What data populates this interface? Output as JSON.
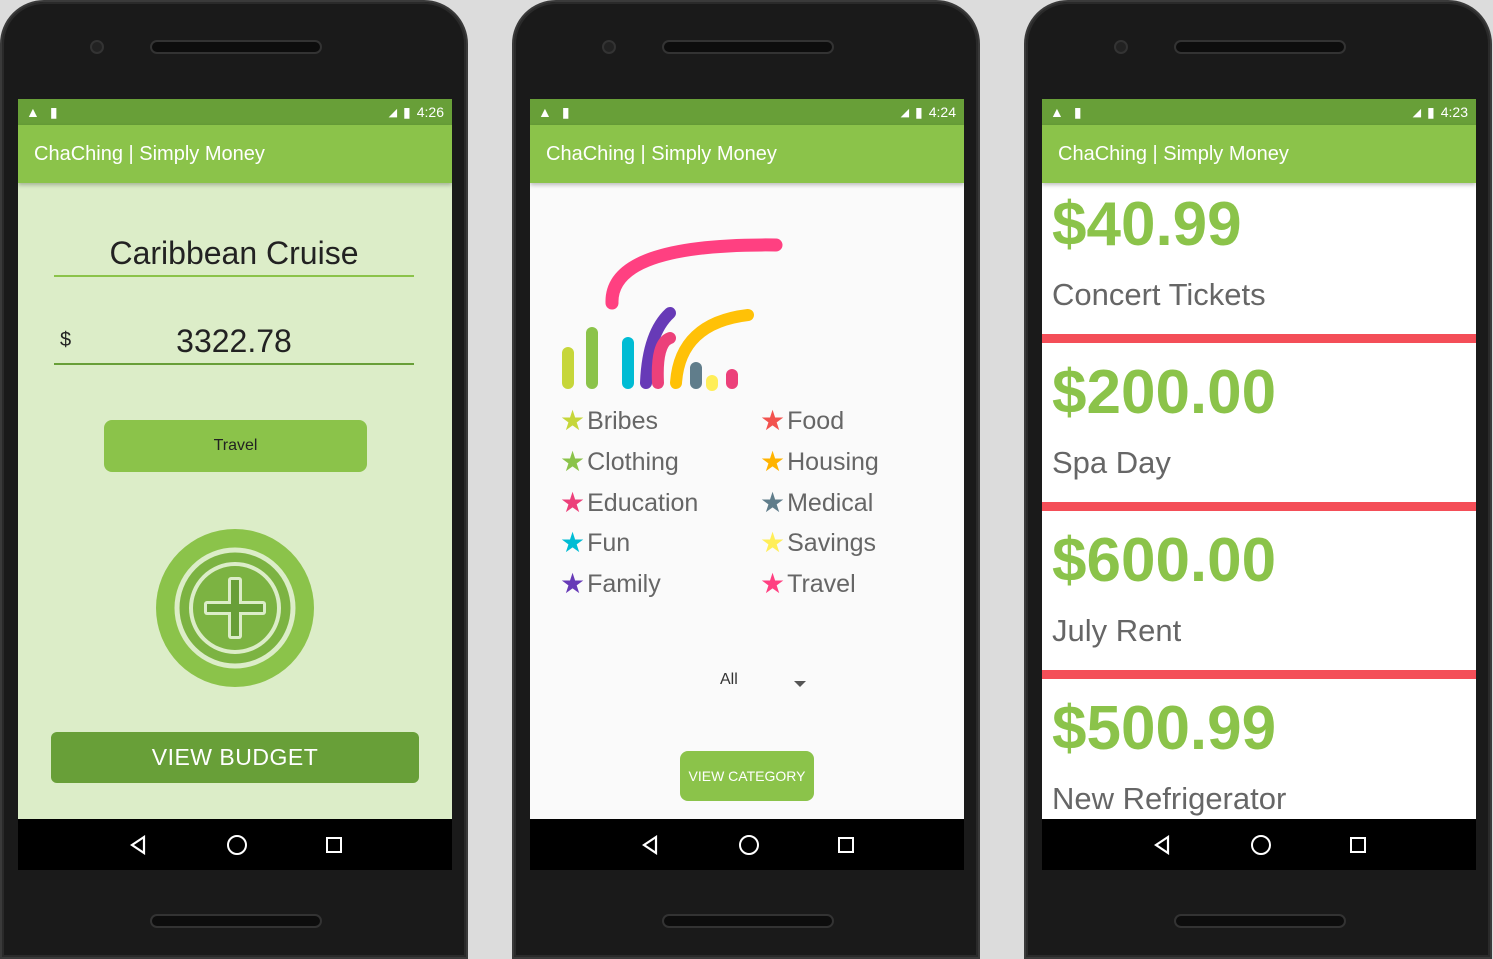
{
  "app_title": "ChaChing | Simply Money",
  "screens": [
    {
      "time": "4:26",
      "budget_name": "Caribbean Cruise",
      "currency_symbol": "$",
      "amount": "3322.78",
      "category_button": "Travel",
      "view_budget": "VIEW BUDGET"
    },
    {
      "time": "4:24",
      "legend": [
        {
          "label": "Bribes",
          "color": "#c6d63a"
        },
        {
          "label": "Food",
          "color": "#f2524e"
        },
        {
          "label": "Clothing",
          "color": "#8bc34a"
        },
        {
          "label": "Housing",
          "color": "#ffb300"
        },
        {
          "label": "Education",
          "color": "#ec407a"
        },
        {
          "label": "Medical",
          "color": "#607d8b"
        },
        {
          "label": "Fun",
          "color": "#00bcd4"
        },
        {
          "label": "Savings",
          "color": "#ffee58"
        },
        {
          "label": "Family",
          "color": "#673ab7"
        },
        {
          "label": "Travel",
          "color": "#ff4081"
        }
      ],
      "spinner_value": "All",
      "view_category": "VIEW CATEGORY"
    },
    {
      "time": "4:23",
      "expenses": [
        {
          "price": "$40.99",
          "desc": "Concert Tickets"
        },
        {
          "price": "$200.00",
          "desc": "Spa Day"
        },
        {
          "price": "$600.00",
          "desc": "July Rent"
        },
        {
          "price": "$500.99",
          "desc": "New Refrigerator"
        }
      ]
    }
  ],
  "status_icons": [
    "warning-icon",
    "sd-card-icon",
    "signal-icon",
    "battery-icon"
  ],
  "nav_icons": [
    "back-icon",
    "home-icon",
    "recents-icon"
  ],
  "colors": {
    "primary": "#8bc34a",
    "primary_dark": "#689f38",
    "accent_red": "#f44e58"
  }
}
